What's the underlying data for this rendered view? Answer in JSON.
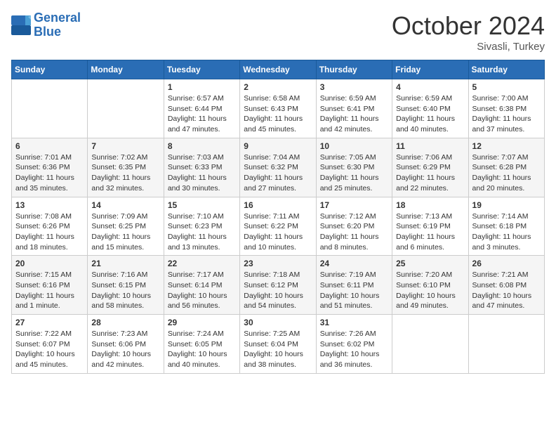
{
  "header": {
    "logo_line1": "General",
    "logo_line2": "Blue",
    "month": "October 2024",
    "location": "Sivasli, Turkey"
  },
  "weekdays": [
    "Sunday",
    "Monday",
    "Tuesday",
    "Wednesday",
    "Thursday",
    "Friday",
    "Saturday"
  ],
  "weeks": [
    [
      {
        "day": "",
        "info": ""
      },
      {
        "day": "",
        "info": ""
      },
      {
        "day": "1",
        "info": "Sunrise: 6:57 AM\nSunset: 6:44 PM\nDaylight: 11 hours and 47 minutes."
      },
      {
        "day": "2",
        "info": "Sunrise: 6:58 AM\nSunset: 6:43 PM\nDaylight: 11 hours and 45 minutes."
      },
      {
        "day": "3",
        "info": "Sunrise: 6:59 AM\nSunset: 6:41 PM\nDaylight: 11 hours and 42 minutes."
      },
      {
        "day": "4",
        "info": "Sunrise: 6:59 AM\nSunset: 6:40 PM\nDaylight: 11 hours and 40 minutes."
      },
      {
        "day": "5",
        "info": "Sunrise: 7:00 AM\nSunset: 6:38 PM\nDaylight: 11 hours and 37 minutes."
      }
    ],
    [
      {
        "day": "6",
        "info": "Sunrise: 7:01 AM\nSunset: 6:36 PM\nDaylight: 11 hours and 35 minutes."
      },
      {
        "day": "7",
        "info": "Sunrise: 7:02 AM\nSunset: 6:35 PM\nDaylight: 11 hours and 32 minutes."
      },
      {
        "day": "8",
        "info": "Sunrise: 7:03 AM\nSunset: 6:33 PM\nDaylight: 11 hours and 30 minutes."
      },
      {
        "day": "9",
        "info": "Sunrise: 7:04 AM\nSunset: 6:32 PM\nDaylight: 11 hours and 27 minutes."
      },
      {
        "day": "10",
        "info": "Sunrise: 7:05 AM\nSunset: 6:30 PM\nDaylight: 11 hours and 25 minutes."
      },
      {
        "day": "11",
        "info": "Sunrise: 7:06 AM\nSunset: 6:29 PM\nDaylight: 11 hours and 22 minutes."
      },
      {
        "day": "12",
        "info": "Sunrise: 7:07 AM\nSunset: 6:28 PM\nDaylight: 11 hours and 20 minutes."
      }
    ],
    [
      {
        "day": "13",
        "info": "Sunrise: 7:08 AM\nSunset: 6:26 PM\nDaylight: 11 hours and 18 minutes."
      },
      {
        "day": "14",
        "info": "Sunrise: 7:09 AM\nSunset: 6:25 PM\nDaylight: 11 hours and 15 minutes."
      },
      {
        "day": "15",
        "info": "Sunrise: 7:10 AM\nSunset: 6:23 PM\nDaylight: 11 hours and 13 minutes."
      },
      {
        "day": "16",
        "info": "Sunrise: 7:11 AM\nSunset: 6:22 PM\nDaylight: 11 hours and 10 minutes."
      },
      {
        "day": "17",
        "info": "Sunrise: 7:12 AM\nSunset: 6:20 PM\nDaylight: 11 hours and 8 minutes."
      },
      {
        "day": "18",
        "info": "Sunrise: 7:13 AM\nSunset: 6:19 PM\nDaylight: 11 hours and 6 minutes."
      },
      {
        "day": "19",
        "info": "Sunrise: 7:14 AM\nSunset: 6:18 PM\nDaylight: 11 hours and 3 minutes."
      }
    ],
    [
      {
        "day": "20",
        "info": "Sunrise: 7:15 AM\nSunset: 6:16 PM\nDaylight: 11 hours and 1 minute."
      },
      {
        "day": "21",
        "info": "Sunrise: 7:16 AM\nSunset: 6:15 PM\nDaylight: 10 hours and 58 minutes."
      },
      {
        "day": "22",
        "info": "Sunrise: 7:17 AM\nSunset: 6:14 PM\nDaylight: 10 hours and 56 minutes."
      },
      {
        "day": "23",
        "info": "Sunrise: 7:18 AM\nSunset: 6:12 PM\nDaylight: 10 hours and 54 minutes."
      },
      {
        "day": "24",
        "info": "Sunrise: 7:19 AM\nSunset: 6:11 PM\nDaylight: 10 hours and 51 minutes."
      },
      {
        "day": "25",
        "info": "Sunrise: 7:20 AM\nSunset: 6:10 PM\nDaylight: 10 hours and 49 minutes."
      },
      {
        "day": "26",
        "info": "Sunrise: 7:21 AM\nSunset: 6:08 PM\nDaylight: 10 hours and 47 minutes."
      }
    ],
    [
      {
        "day": "27",
        "info": "Sunrise: 7:22 AM\nSunset: 6:07 PM\nDaylight: 10 hours and 45 minutes."
      },
      {
        "day": "28",
        "info": "Sunrise: 7:23 AM\nSunset: 6:06 PM\nDaylight: 10 hours and 42 minutes."
      },
      {
        "day": "29",
        "info": "Sunrise: 7:24 AM\nSunset: 6:05 PM\nDaylight: 10 hours and 40 minutes."
      },
      {
        "day": "30",
        "info": "Sunrise: 7:25 AM\nSunset: 6:04 PM\nDaylight: 10 hours and 38 minutes."
      },
      {
        "day": "31",
        "info": "Sunrise: 7:26 AM\nSunset: 6:02 PM\nDaylight: 10 hours and 36 minutes."
      },
      {
        "day": "",
        "info": ""
      },
      {
        "day": "",
        "info": ""
      }
    ]
  ]
}
